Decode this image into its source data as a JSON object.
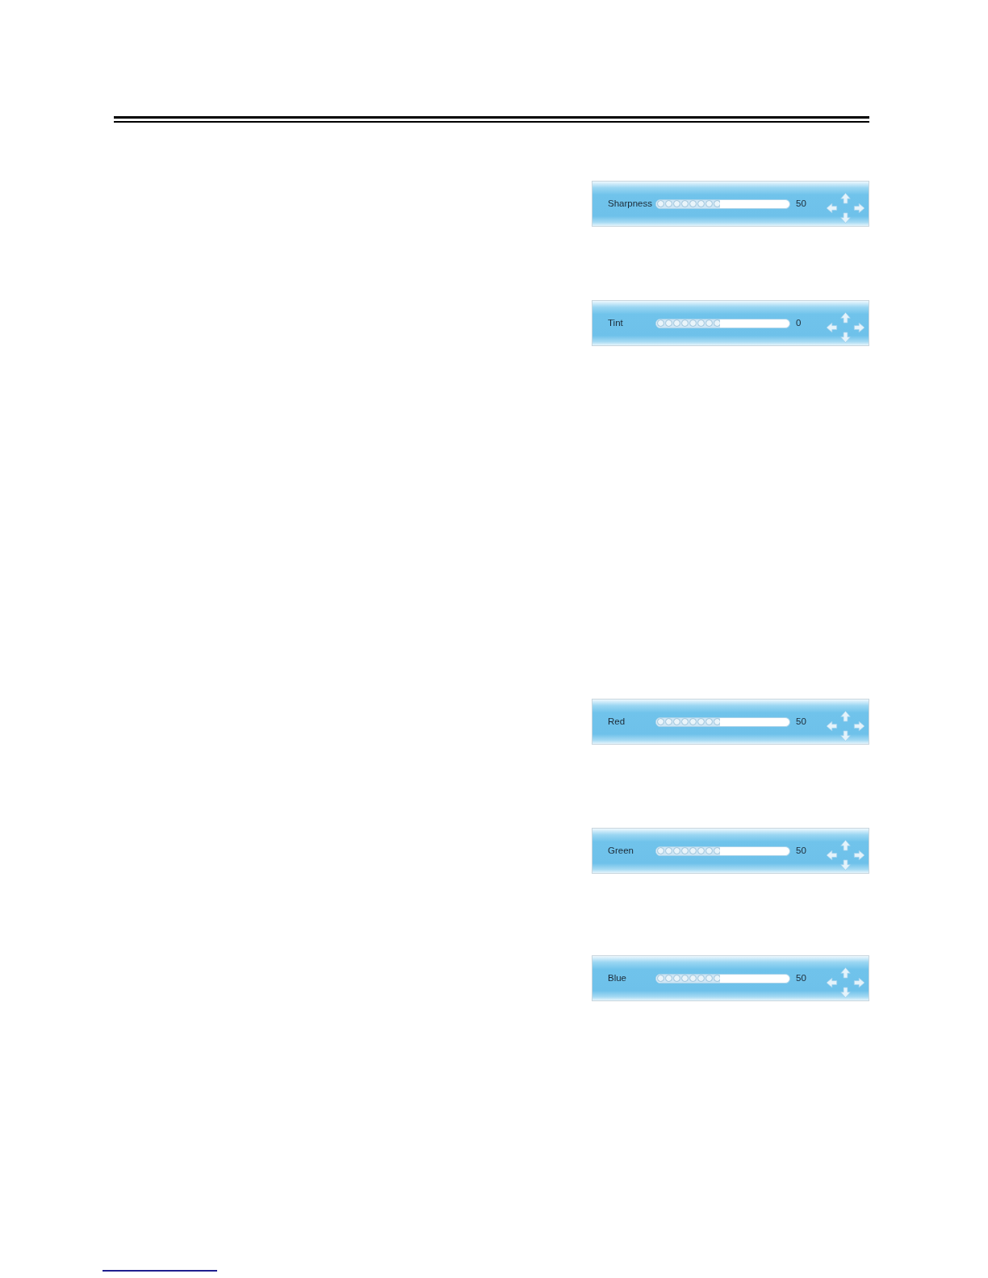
{
  "sliders": [
    {
      "label": "Sharpness",
      "level": 0.48,
      "reading": "50"
    },
    {
      "label": "Tint",
      "level": 0.48,
      "reading": "0"
    },
    {
      "label": "Red",
      "level": 0.48,
      "reading": "50"
    },
    {
      "label": "Green",
      "level": 0.48,
      "reading": "50"
    },
    {
      "label": "Blue",
      "level": 0.48,
      "reading": "50"
    }
  ]
}
